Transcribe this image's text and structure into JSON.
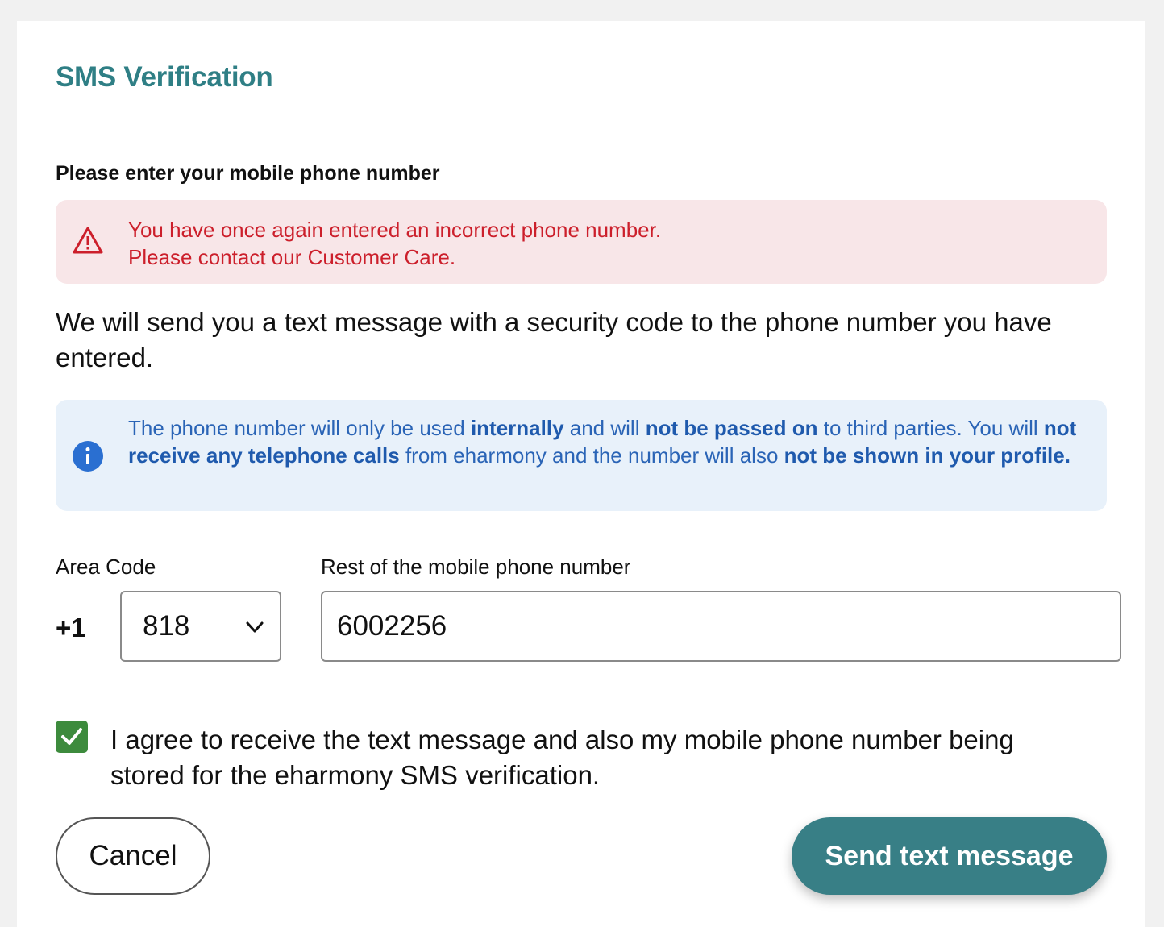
{
  "header": {
    "title": "SMS Verification"
  },
  "form": {
    "prompt": "Please enter your mobile phone number",
    "error": {
      "line1": "You have once again entered an incorrect phone number.",
      "line2": "Please contact our Customer Care.",
      "icon": "warning-triangle-icon",
      "color": "#cc1f2b"
    },
    "intro": "We will send you a text message with a security code to the phone number you have entered.",
    "info": {
      "icon": "info-circle-icon",
      "t1": "The phone number will only be used ",
      "b1": "internally",
      "t2": " and will ",
      "b2": "not be passed on",
      "t3": " to third parties. You will ",
      "b3": "not receive any telephone calls",
      "t4": " from eharmony and the number will also ",
      "b4": "not be shown in your profile."
    },
    "area_code_label": "Area Code",
    "country_code": "+1",
    "area_code_value": "818",
    "rest_label": "Rest of the mobile phone number",
    "rest_value": "6002256",
    "consent_checked": true,
    "consent_text": "I agree to receive the text message and also my mobile phone number being stored for the eharmony SMS verification."
  },
  "actions": {
    "cancel_label": "Cancel",
    "send_label": "Send text message"
  },
  "colors": {
    "accent": "#387f86",
    "title": "#2f7f85",
    "info_text": "#2a64b6",
    "checkbox": "#3d8b3d"
  }
}
